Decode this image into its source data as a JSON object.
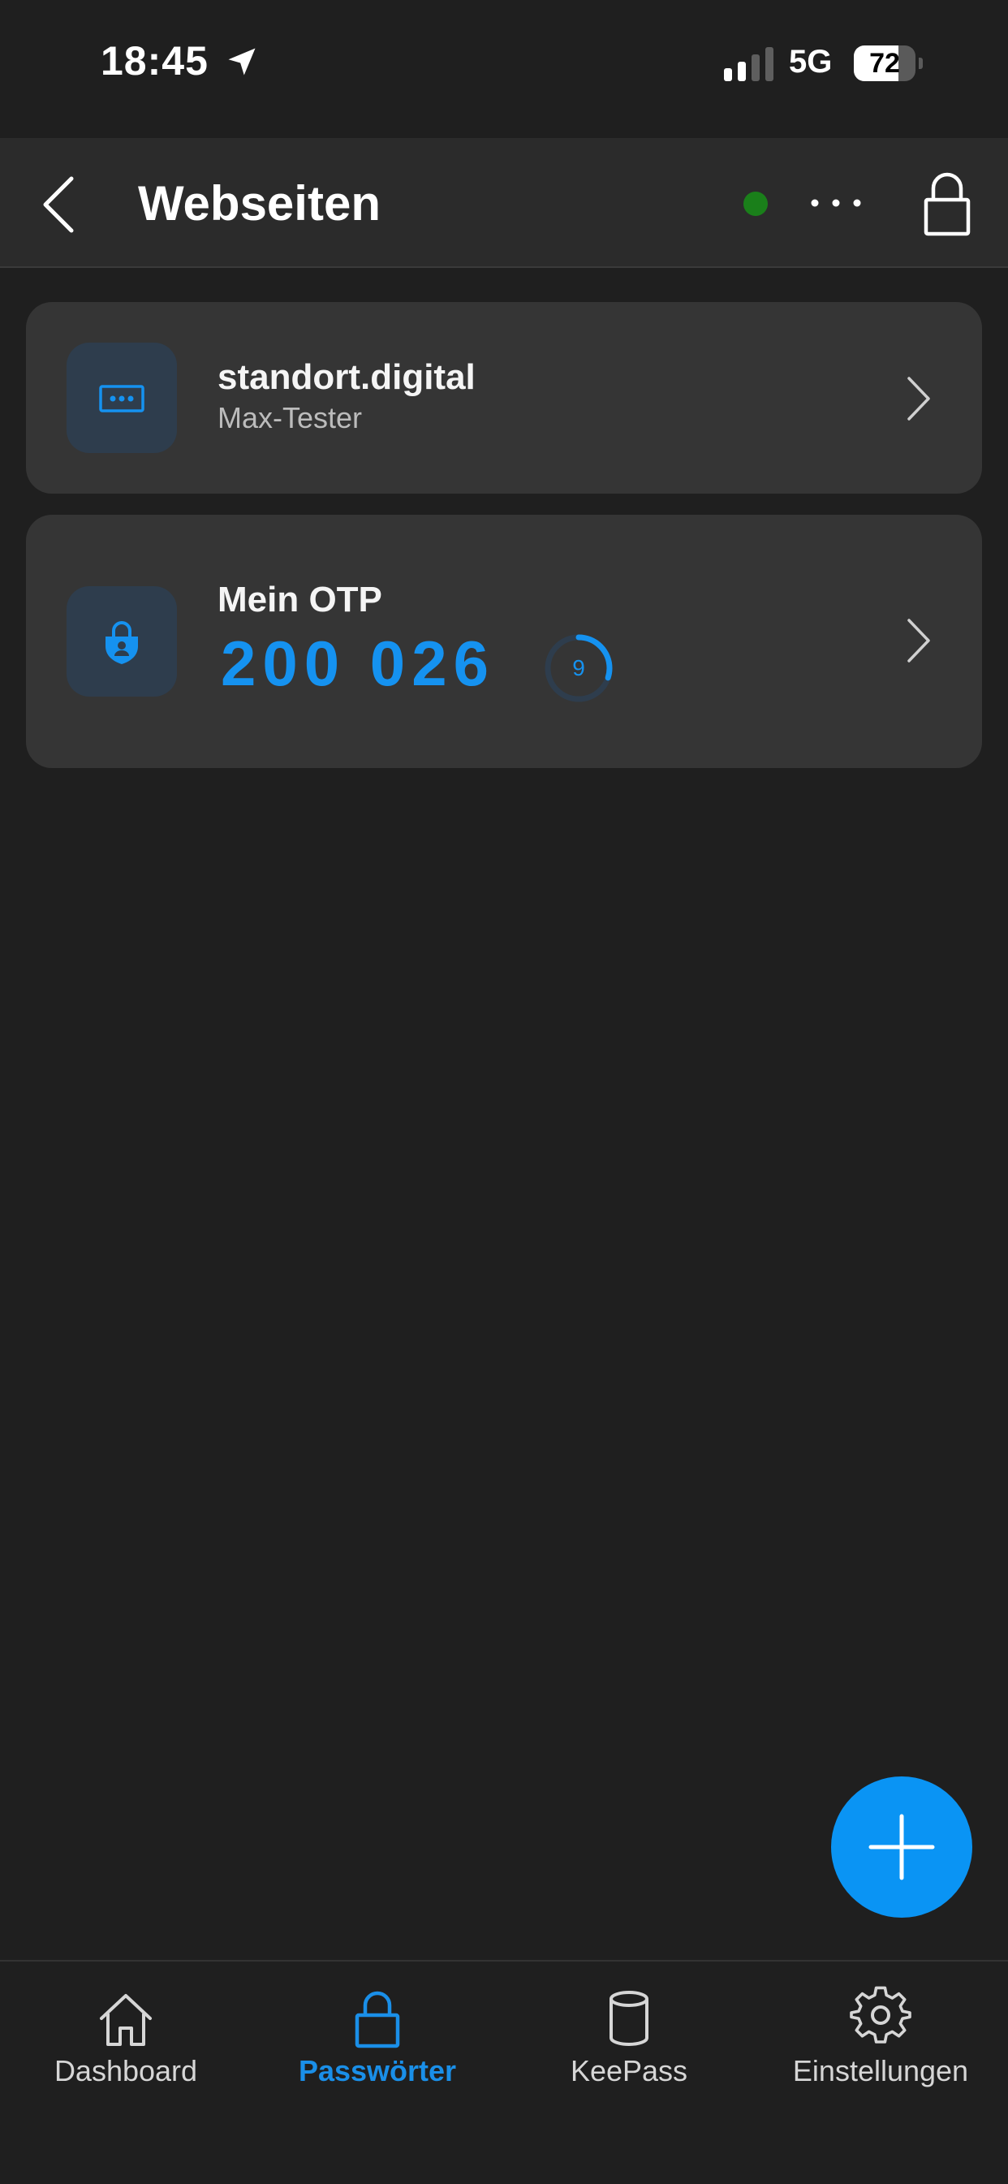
{
  "status_bar": {
    "time": "18:45",
    "network": "5G",
    "battery_percent": "72",
    "battery_level": 0.72
  },
  "header": {
    "title": "Webseiten",
    "connection_status_color": "#1a7f1a"
  },
  "entries": [
    {
      "title": "standort.digital",
      "subtitle": "Max-Tester",
      "icon": "password-dots-icon"
    },
    {
      "title": "Mein OTP",
      "otp_code": "200 026",
      "seconds_remaining": "9",
      "seconds_fraction": 0.3,
      "icon": "shield-lock-icon"
    }
  ],
  "fab": {
    "icon": "plus-icon"
  },
  "bottom_nav": {
    "items": [
      {
        "label": "Dashboard",
        "icon": "home-icon",
        "active": false
      },
      {
        "label": "Passwörter",
        "icon": "lock-icon",
        "active": true
      },
      {
        "label": "KeePass",
        "icon": "database-icon",
        "active": false
      },
      {
        "label": "Einstellungen",
        "icon": "gear-icon",
        "active": false
      }
    ]
  },
  "colors": {
    "accent": "#1592f0",
    "background": "#1f1f1f",
    "card": "#353535",
    "header": "#2b2b2b"
  }
}
